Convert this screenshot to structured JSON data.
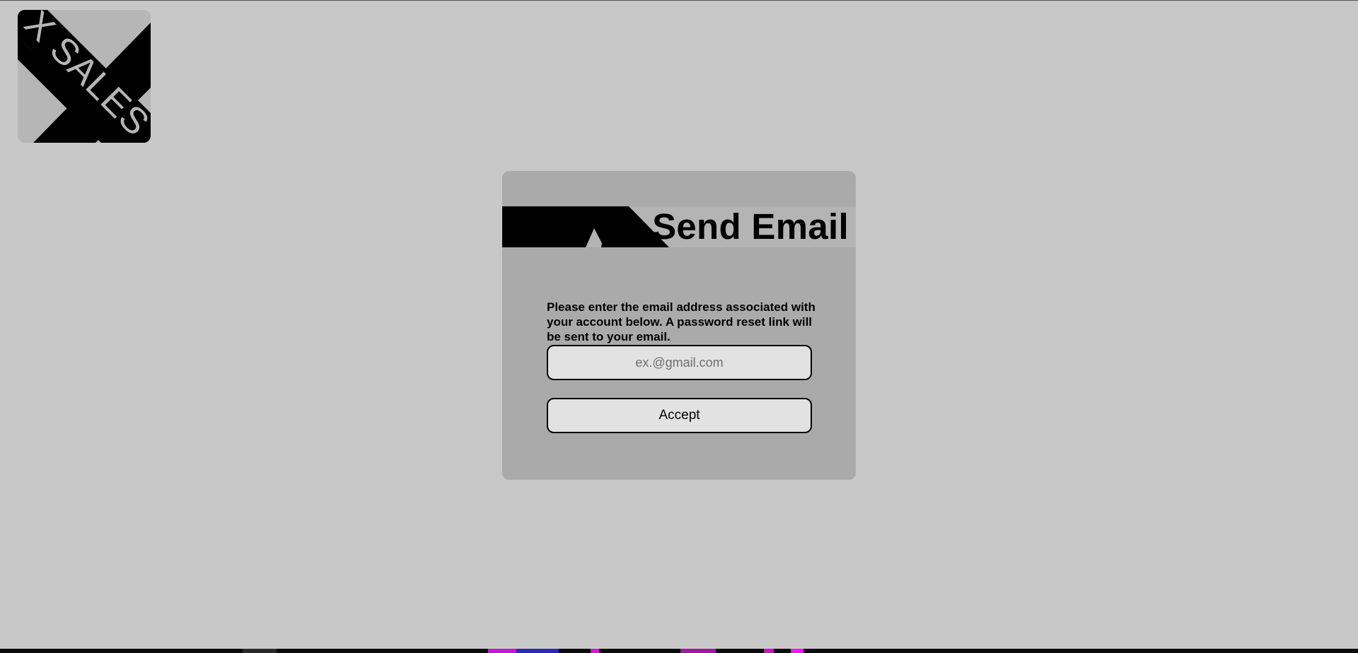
{
  "logo": {
    "text": "X SALES",
    "icon": "x-sales-logo"
  },
  "card": {
    "title": "Send Email",
    "instructions": "Please enter the email address associated with your account below. A password reset link will be sent to your email.",
    "email_placeholder": "ex.@gmail.com",
    "email_value": "",
    "accept_label": "Accept"
  },
  "colors": {
    "page_background": "#c8c8c8",
    "card_background": "#aaaaaa",
    "header_band": "#b4b4b4",
    "control_fill": "#e2e2e2",
    "ink": "#000000"
  }
}
